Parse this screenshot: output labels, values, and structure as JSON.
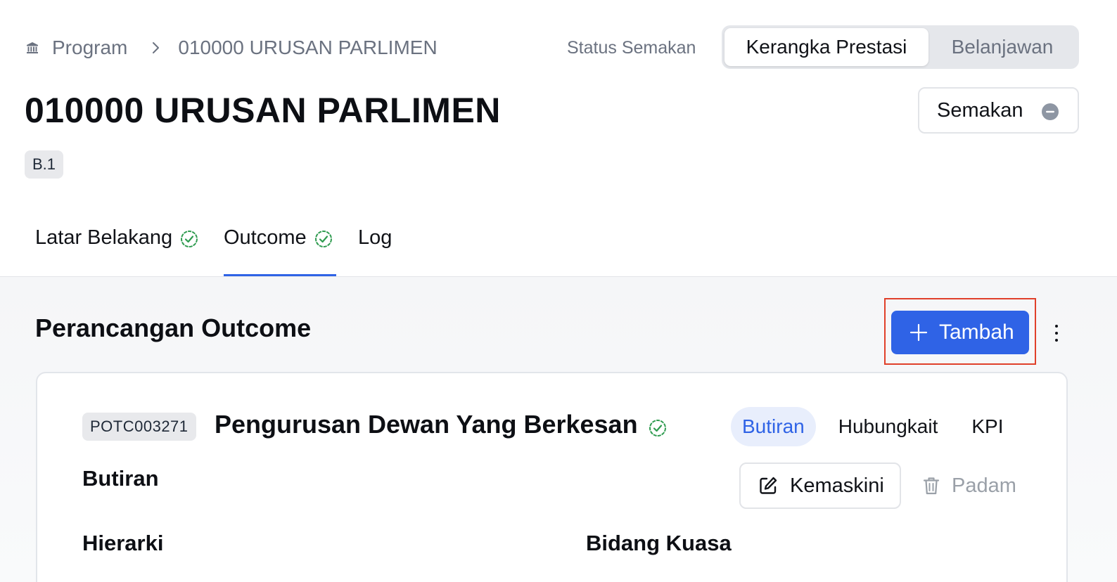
{
  "breadcrumb": {
    "program_label": "Program",
    "current_label": "010000 URUSAN PARLIMEN",
    "home_icon": "bank-icon",
    "separator_icon": "chevron-right-icon"
  },
  "status": {
    "label": "Status Semakan"
  },
  "view_toggle": {
    "options": [
      "Kerangka Prestasi",
      "Belanjawan"
    ],
    "selected": "Kerangka Prestasi"
  },
  "page": {
    "title": "010000 URUSAN PARLIMEN",
    "code": "B.1"
  },
  "review_button": {
    "label": "Semakan",
    "icon": "minus-circle-icon"
  },
  "tabs": [
    {
      "label": "Latar Belakang",
      "completed": true
    },
    {
      "label": "Outcome",
      "completed": true
    },
    {
      "label": "Log",
      "completed": false
    }
  ],
  "active_tab": "Outcome",
  "section": {
    "title": "Perancangan Outcome",
    "add_label": "Tambah",
    "add_icon": "plus-icon",
    "more_icon": "kebab-menu-icon"
  },
  "outcome_card": {
    "code": "POTC003271",
    "title": "Pengurusan Dewan Yang Berkesan",
    "verified": true,
    "inner_tabs": [
      "Butiran",
      "Hubungkait",
      "KPI"
    ],
    "active_inner_tab": "Butiran",
    "details_heading": "Butiran",
    "edit_label": "Kemaskini",
    "edit_icon": "edit-icon",
    "delete_label": "Padam",
    "delete_icon": "trash-icon",
    "hierarki_heading": "Hierarki",
    "bidang_heading": "Bidang Kuasa"
  },
  "colors": {
    "accent": "#2f63e6",
    "success": "#2e9b4f",
    "highlight": "#e0402a",
    "muted_text": "#6b7280"
  }
}
